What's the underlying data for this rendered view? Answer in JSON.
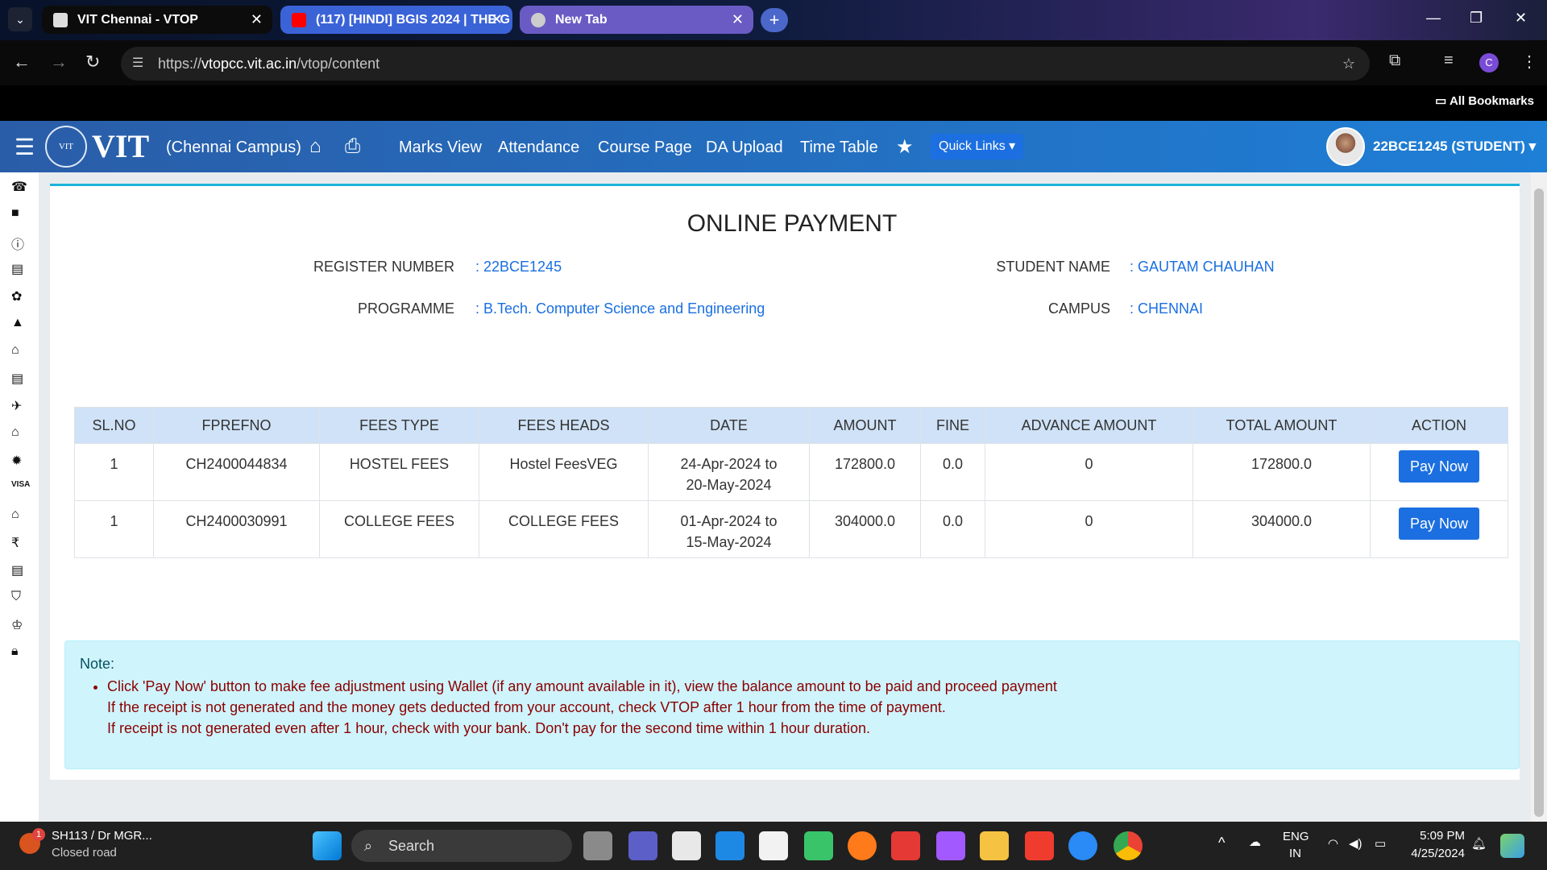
{
  "browser": {
    "tabs": [
      {
        "label": "VIT Chennai - VTOP"
      },
      {
        "label": "(117) [HINDI] BGIS 2024 | THE G"
      },
      {
        "label": "New Tab"
      }
    ],
    "url_prefix": "https://",
    "url_host": "vtopcc.vit.ac.in",
    "url_path": "/vtop/content",
    "all_bookmarks": "All Bookmarks",
    "profile": "C"
  },
  "navbar": {
    "logo": "VIT",
    "brand": "VIT",
    "campus": "(Chennai Campus)",
    "links": [
      "Marks View",
      "Attendance",
      "Course Page",
      "DA Upload",
      "Time Table"
    ],
    "quick_links": "Quick Links",
    "user": "22BCE1245 (STUDENT)"
  },
  "page": {
    "title": "ONLINE PAYMENT",
    "fields": {
      "reg_label": "REGISTER NUMBER",
      "reg_value": ": 22BCE1245",
      "name_label": "STUDENT NAME",
      "name_value": ": GAUTAM CHAUHAN",
      "prog_label": "PROGRAMME",
      "prog_value": ": B.Tech. Computer Science and Engineering",
      "campus_label": "CAMPUS",
      "campus_value": ": CHENNAI"
    },
    "table": {
      "headers": [
        "SL.NO",
        "FPREFNO",
        "FEES TYPE",
        "FEES HEADS",
        "DATE",
        "AMOUNT",
        "FINE",
        "ADVANCE AMOUNT",
        "TOTAL AMOUNT",
        "ACTION"
      ],
      "rows": [
        {
          "sl": "1",
          "ref": "CH2400044834",
          "type": "HOSTEL FEES",
          "heads": "Hostel FeesVEG",
          "date1": "24-Apr-2024 to",
          "date2": "20-May-2024",
          "amount": "172800.0",
          "fine": "0.0",
          "advance": "0",
          "total": "172800.0",
          "action": "Pay Now"
        },
        {
          "sl": "1",
          "ref": "CH2400030991",
          "type": "COLLEGE FEES",
          "heads": "COLLEGE FEES",
          "date1": "01-Apr-2024 to",
          "date2": "15-May-2024",
          "amount": "304000.0",
          "fine": "0.0",
          "advance": "0",
          "total": "304000.0",
          "action": "Pay Now"
        }
      ]
    },
    "note": {
      "title": "Note:",
      "line1": "Click 'Pay Now' button to make fee adjustment using Wallet (if any amount available in it), view the balance amount to be paid and proceed payment",
      "line2": "If the receipt is not generated and the money gets deducted from your account, check VTOP after 1 hour from the time of payment.",
      "line3": "If receipt is not generated even after 1 hour, check with your bank. Don't pay for the second time within 1 hour duration."
    }
  },
  "taskbar": {
    "weather_title": "SH113 / Dr MGR...",
    "weather_sub": "Closed road",
    "badge": "1",
    "search": "Search",
    "lang1": "ENG",
    "lang2": "IN",
    "time": "5:09 PM",
    "date": "4/25/2024"
  },
  "colors": {
    "navbar": "#2a5da8",
    "accent": "#1c6fe0",
    "note_bg": "#cff4fc",
    "note_text": "#8b0000"
  }
}
